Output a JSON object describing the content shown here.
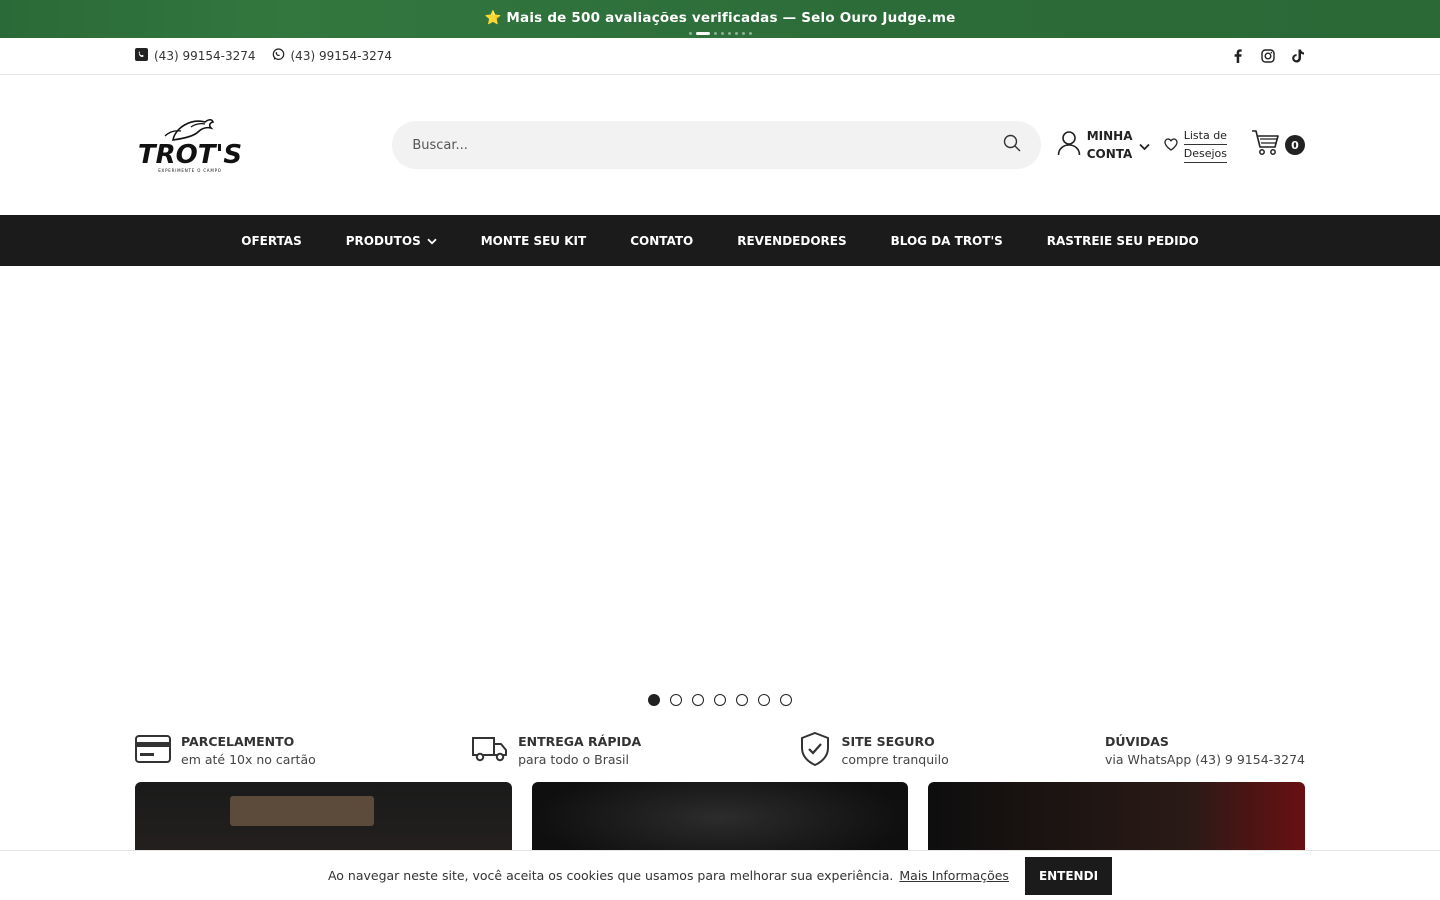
{
  "announcement": {
    "text": "⭐ Mais de 500 avaliações verificadas — Selo Ouro Judge.me",
    "slides": 8,
    "active": 1
  },
  "topbar": {
    "phone": "(43) 99154-3274",
    "whatsapp": "(43) 99154-3274",
    "social": [
      "facebook-icon",
      "instagram-icon",
      "tiktok-icon"
    ]
  },
  "header": {
    "logo_alt": "TROT'S",
    "search_placeholder": "Buscar...",
    "account_label": "MINHA CONTA",
    "wishlist_line1": "Lista de",
    "wishlist_line2": "Desejos",
    "cart_count": "0"
  },
  "nav": {
    "items": [
      "OFERTAS",
      "PRODUTOS",
      "MONTE SEU KIT",
      "CONTATO",
      "REVENDEDORES",
      "BLOG DA TROT'S",
      "RASTREIE SEU PEDIDO"
    ]
  },
  "hero": {
    "slides": 7,
    "active": 0
  },
  "features": [
    {
      "title": "PARCELAMENTO",
      "subtitle": "em até 10x no cartão",
      "icon": "credit-card-icon"
    },
    {
      "title": "ENTREGA RÁPIDA",
      "subtitle": "para todo o Brasil",
      "icon": "truck-icon"
    },
    {
      "title": "SITE SEGURO",
      "subtitle": "compre tranquilo",
      "icon": "shield-check-icon"
    },
    {
      "title": "DÚVIDAS",
      "subtitle": "via WhatsApp (43) 9 9154-3274",
      "icon": ""
    }
  ],
  "cookie": {
    "text": "Ao navegar neste site, você aceita os cookies que usamos para melhorar sua experiência.",
    "more": "Mais Informações",
    "button": "ENTENDI"
  },
  "colors": {
    "announcement_bg": "#2b6a37",
    "nav_bg": "#1b1b1b",
    "search_bg": "#f2f2f2"
  }
}
